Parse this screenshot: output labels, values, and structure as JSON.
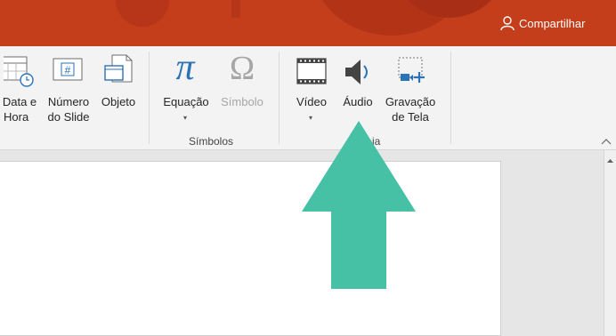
{
  "header": {
    "share_label": "Compartilhar"
  },
  "ribbon": {
    "data_hora": {
      "line1": "Data e",
      "line2": "Hora"
    },
    "numero_slide": {
      "line1": "Número",
      "line2": "do Slide"
    },
    "objeto": "Objeto",
    "equacao": "Equação",
    "simbolo": "Símbolo",
    "simbolos_group": "Símbolos",
    "video": "Vídeo",
    "audio": "Áudio",
    "gravacao": {
      "line1": "Gravação",
      "line2": "de Tela"
    },
    "midia_group_partial": "ia",
    "icons": {
      "pi": "π",
      "omega": "Ω",
      "hash": "#"
    }
  },
  "colors": {
    "titlebar": "#c43e1c",
    "arrow": "#47c1a6"
  }
}
